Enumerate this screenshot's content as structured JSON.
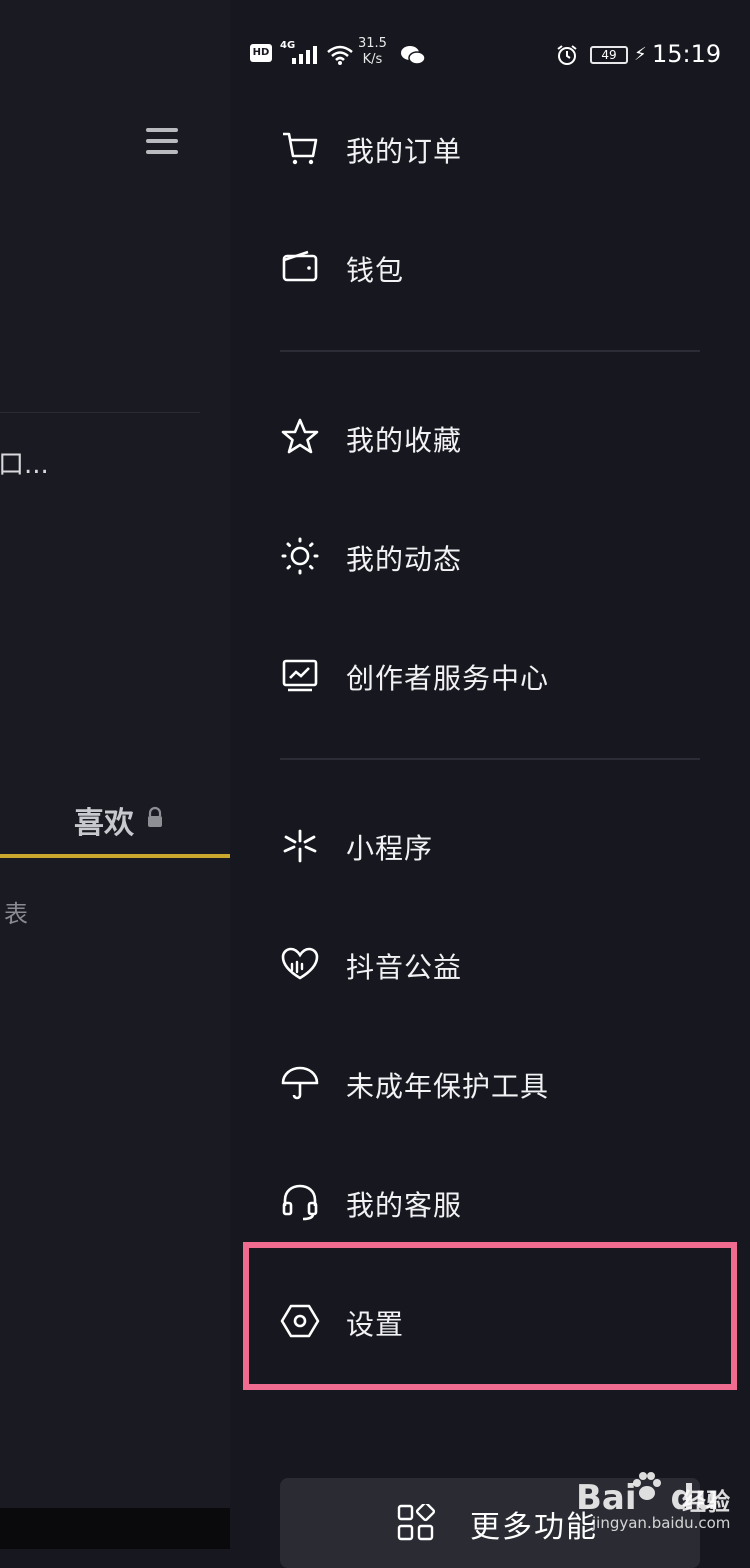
{
  "left_pane": {
    "truncated_text": "口...",
    "likes_tab_label": "喜欢",
    "table_text": "表"
  },
  "status_bar": {
    "hd": "HD",
    "network": "4G",
    "speed_value": "31.5",
    "speed_unit": "K/s",
    "battery": "49",
    "time": "15:19"
  },
  "menu": {
    "items": [
      {
        "label": "我的订单",
        "icon": "cart-icon"
      },
      {
        "label": "钱包",
        "icon": "wallet-icon"
      },
      {
        "label": "我的收藏",
        "icon": "star-icon"
      },
      {
        "label": "我的动态",
        "icon": "sun-icon"
      },
      {
        "label": "创作者服务中心",
        "icon": "chart-monitor-icon"
      },
      {
        "label": "小程序",
        "icon": "mini-program-icon"
      },
      {
        "label": "抖音公益",
        "icon": "charity-heart-icon"
      },
      {
        "label": "未成年保护工具",
        "icon": "umbrella-icon"
      },
      {
        "label": "我的客服",
        "icon": "headset-icon"
      },
      {
        "label": "设置",
        "icon": "settings-hexagon-icon"
      }
    ],
    "more_label": "更多功能"
  },
  "watermark": {
    "logo_text": "Bai",
    "logo_text_2": "du",
    "cn_text": "经验",
    "url": "jingyan.baidu.com"
  },
  "colors": {
    "highlight": "#f06b90",
    "tab_underline": "#c9a82d",
    "background": "#17181f"
  }
}
